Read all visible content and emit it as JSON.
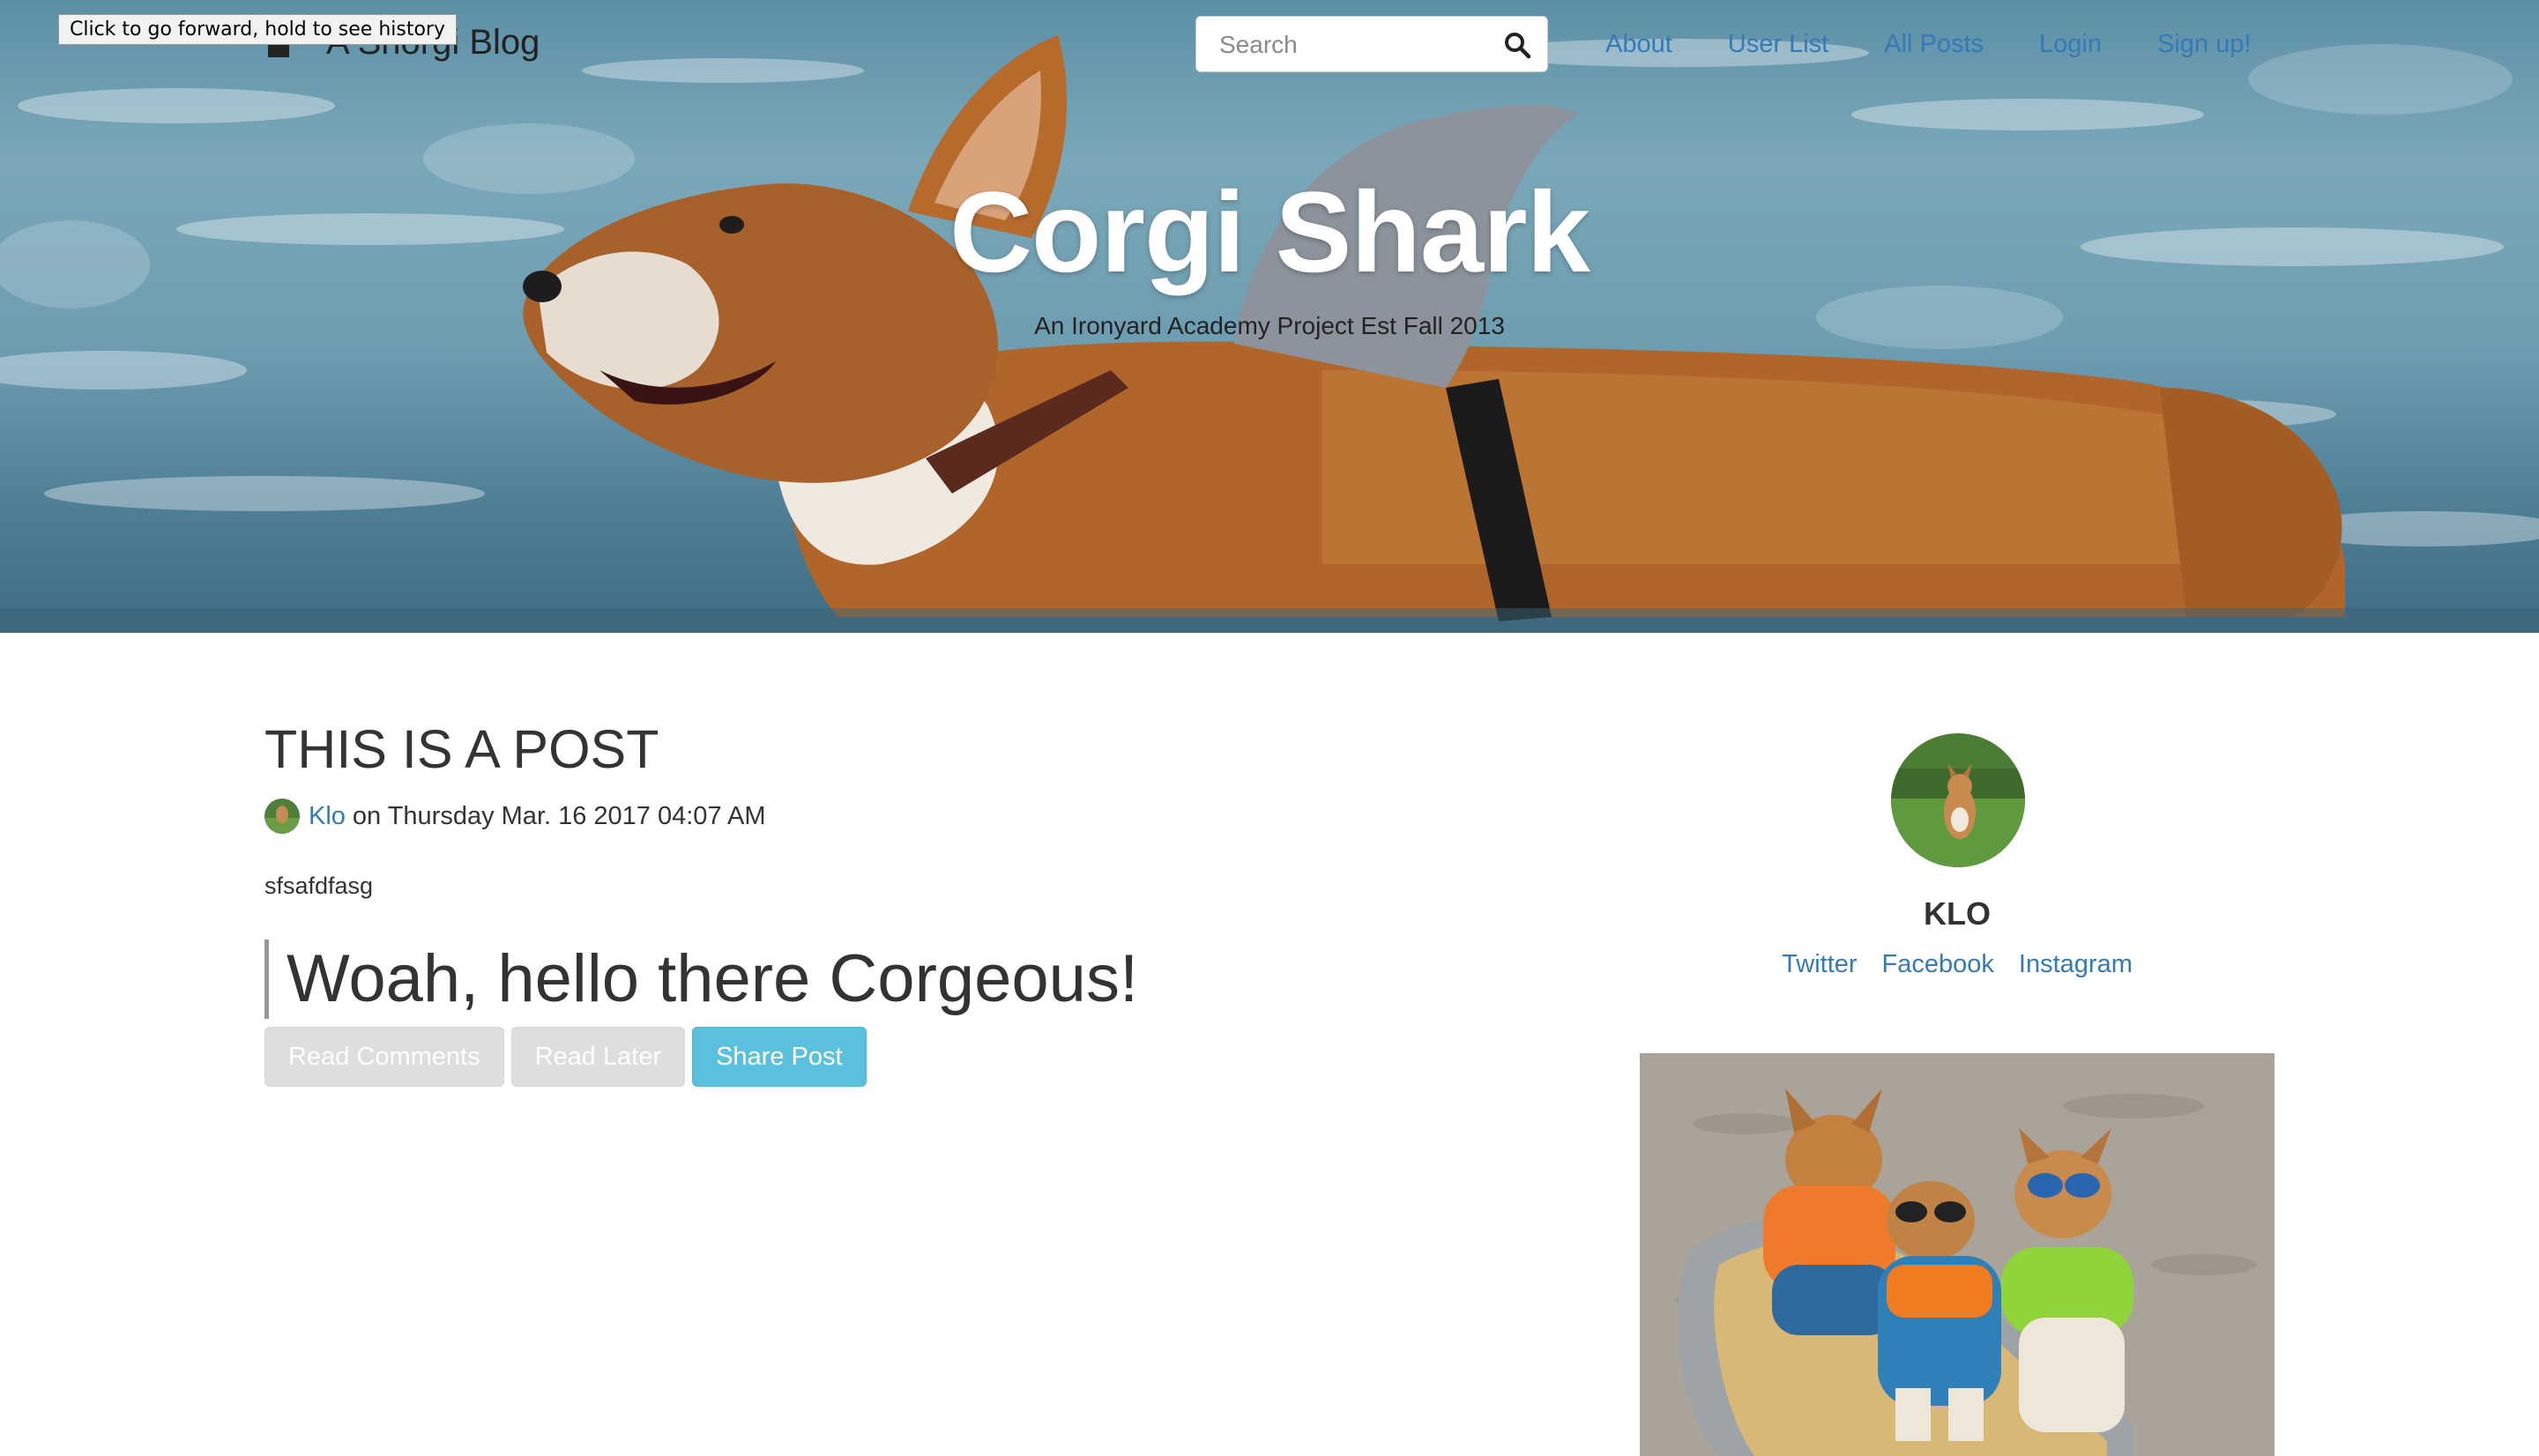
{
  "browser": {
    "tooltip": "Click to go forward, hold to see history"
  },
  "brand": {
    "name": "A Shorgi Blog",
    "icon": "corgi-logo-icon"
  },
  "search": {
    "placeholder": "Search",
    "icon": "search-icon"
  },
  "nav": {
    "links": [
      "About",
      "User List",
      "All Posts",
      "Login",
      "Sign up!"
    ]
  },
  "hero": {
    "title": "Corgi Shark",
    "subtitle": "An Ironyard Academy Project Est Fall 2013"
  },
  "post": {
    "title": "THIS IS A POST",
    "author": "Klo",
    "date_text": "on Thursday Mar. 16 2017 04:07 AM",
    "body": "sfsafdfasg",
    "quote": "Woah, hello there Corgeous!",
    "buttons": {
      "read_comments": "Read Comments",
      "read_later": "Read Later",
      "share": "Share Post"
    }
  },
  "sidebar": {
    "name": "KLO",
    "socials": [
      "Twitter",
      "Facebook",
      "Instagram"
    ]
  },
  "colors": {
    "link": "#337ab7",
    "info_button": "#5bc0de",
    "disabled_button": "#dedede",
    "text": "#333333"
  }
}
